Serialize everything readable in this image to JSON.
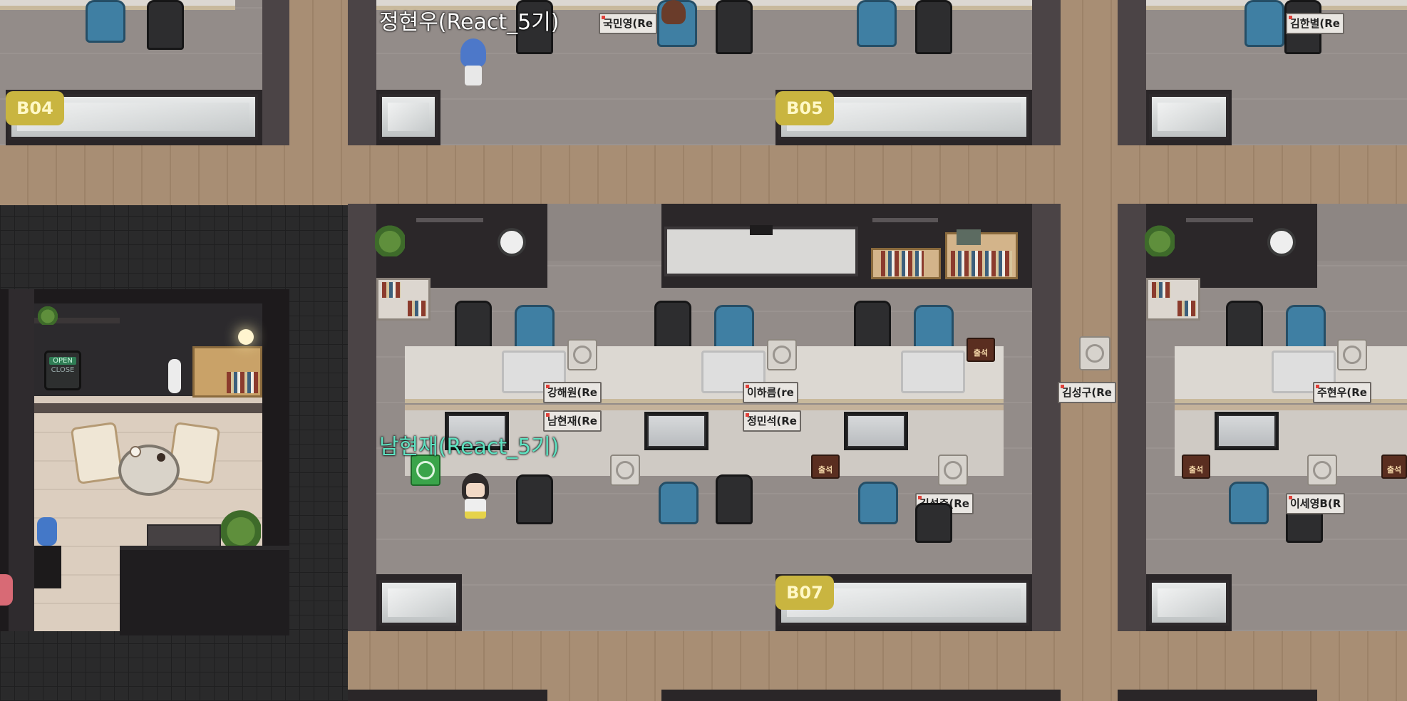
{
  "rooms": {
    "b04": {
      "label": "B04"
    },
    "b05": {
      "label": "B05"
    },
    "b07": {
      "label": "B07"
    }
  },
  "players": {
    "top": {
      "name": "정현우(React_5기)"
    },
    "me": {
      "name": "남현재(React_5기)"
    }
  },
  "nameplates": {
    "top_1": "국민영(Re",
    "top_2": "김한별(Re",
    "r1_1": "강해원(Re",
    "r1_2": "이하름(re",
    "r2_1": "남현재(Re",
    "r2_2": "정민석(Re",
    "r2_3": "김성준(Re",
    "hall": "김성구(Re",
    "right_1": "주현우(Re",
    "right_2": "이세영B(R"
  },
  "badges": {
    "attend": "출석"
  },
  "lounge": {
    "sign_open": "OPEN",
    "sign_close": "CLOSE"
  },
  "colors": {
    "room_tag": "#c9b540",
    "my_name": "#5fe3c2",
    "other_name": "#ffffff",
    "power_on": "#3aa44a"
  },
  "icons": [
    "power-icon",
    "clock-icon",
    "plant-icon",
    "monitor-icon",
    "chair-icon",
    "bookshelf-icon",
    "water-cooler-icon"
  ]
}
